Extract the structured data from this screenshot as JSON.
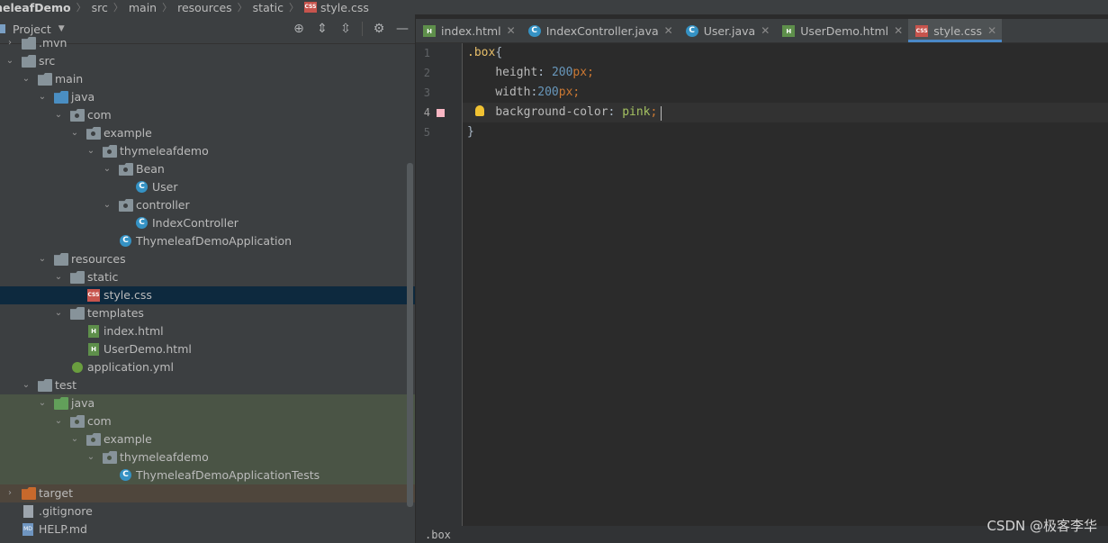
{
  "breadcrumb": {
    "project": "meleafDemo",
    "items": [
      "src",
      "main",
      "resources",
      "static",
      "style.css"
    ]
  },
  "project_panel": {
    "title": "Project",
    "dropdown_icon": "triangle-down-icon",
    "tools": [
      "crosshair-icon",
      "expand-all-icon",
      "collapse-all-icon",
      "gear-icon",
      "minimize-icon"
    ]
  },
  "tree": [
    {
      "label": ".mvn"
    },
    {
      "label": "src"
    },
    {
      "label": "main"
    },
    {
      "label": "java"
    },
    {
      "label": "com"
    },
    {
      "label": "example"
    },
    {
      "label": "thymeleafdemo"
    },
    {
      "label": "Bean"
    },
    {
      "label": "User"
    },
    {
      "label": "controller"
    },
    {
      "label": "IndexController"
    },
    {
      "label": "ThymeleafDemoApplication"
    },
    {
      "label": "resources"
    },
    {
      "label": "static"
    },
    {
      "label": "style.css"
    },
    {
      "label": "templates"
    },
    {
      "label": "index.html"
    },
    {
      "label": "UserDemo.html"
    },
    {
      "label": "application.yml"
    },
    {
      "label": "test"
    },
    {
      "label": "java"
    },
    {
      "label": "com"
    },
    {
      "label": "example"
    },
    {
      "label": "thymeleafdemo"
    },
    {
      "label": "ThymeleafDemoApplicationTests"
    },
    {
      "label": "target"
    },
    {
      "label": ".gitignore"
    },
    {
      "label": "HELP.md"
    }
  ],
  "tabs": [
    {
      "label": "index.html",
      "icon": "html-file-icon"
    },
    {
      "label": "IndexController.java",
      "icon": "java-class-icon"
    },
    {
      "label": "User.java",
      "icon": "java-class-icon"
    },
    {
      "label": "UserDemo.html",
      "icon": "html-file-icon"
    },
    {
      "label": "style.css",
      "icon": "css-file-icon",
      "active": true
    }
  ],
  "editor": {
    "line_numbers": [
      "1",
      "2",
      "3",
      "4",
      "5"
    ],
    "current_line": "4",
    "code": {
      "l1_selector": ".box",
      "l1_brace": "{",
      "l2_prop": "height",
      "l2_colon": ": ",
      "l2_num": "200",
      "l2_unit": "px",
      "l2_semi": ";",
      "l3_prop": "width",
      "l3_colon": ":",
      "l3_num": "200",
      "l3_unit": "px",
      "l3_semi": ";",
      "l4_prop": "background-color",
      "l4_colon": ": ",
      "l4_val": "pink",
      "l4_semi": ";",
      "l5_brace": "}"
    },
    "breakpoint_color": "#f8b6c3",
    "intention_icon": "lightbulb-icon"
  },
  "status": {
    "breadcrumb": ".box"
  },
  "watermark": "CSDN @极客李华",
  "colors": {
    "selector": "#e8bf6a",
    "number": "#6897bb",
    "keyword": "#cc7832",
    "string": "#a5c261",
    "selection": "#0d293e",
    "accent": "#4a88c7"
  }
}
